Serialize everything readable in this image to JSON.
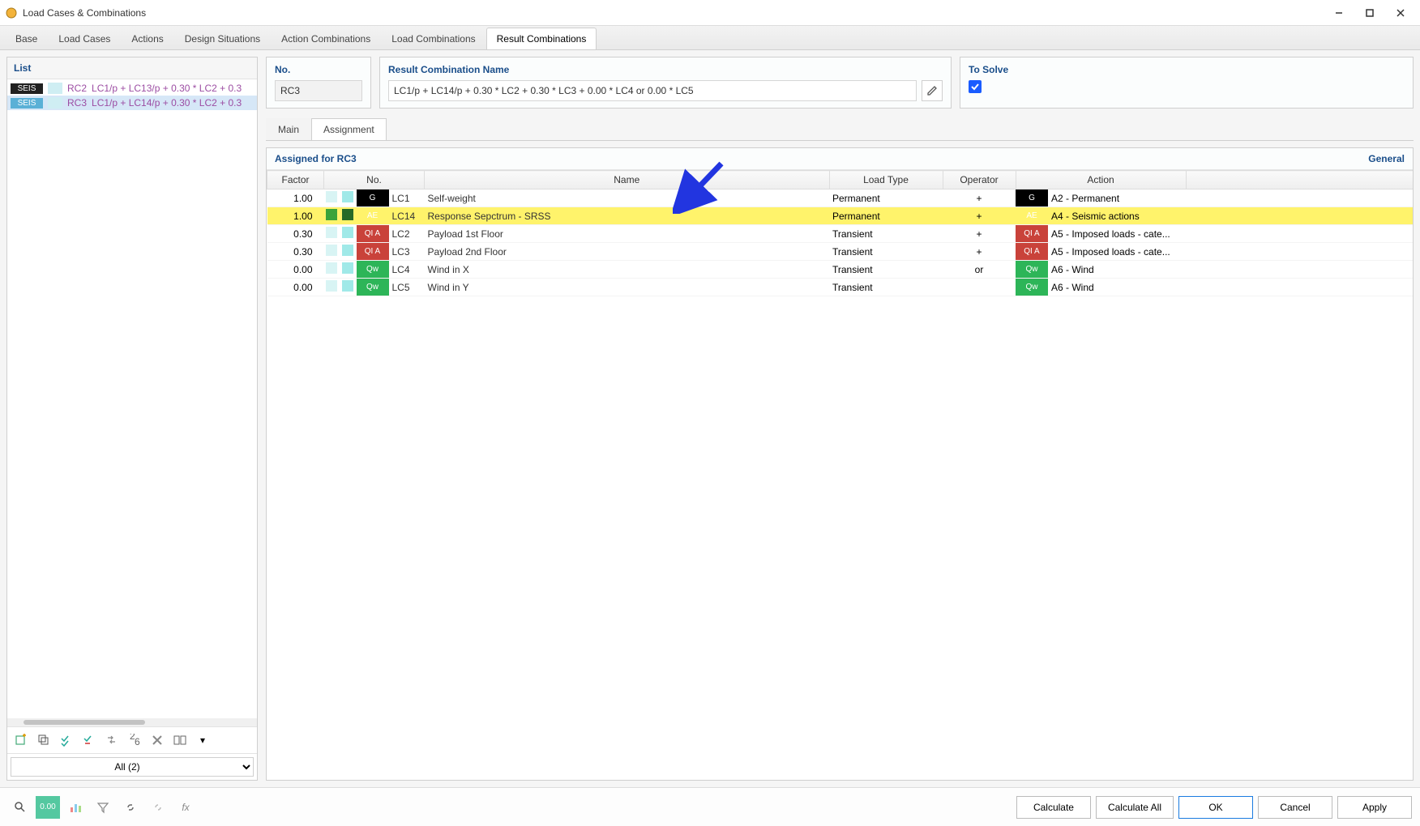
{
  "window": {
    "title": "Load Cases & Combinations"
  },
  "tabs": [
    "Base",
    "Load Cases",
    "Actions",
    "Design Situations",
    "Action Combinations",
    "Load Combinations",
    "Result Combinations"
  ],
  "activeTab": 6,
  "list": {
    "title": "List",
    "items": [
      {
        "tag": "SEIS",
        "rc": "RC2",
        "desc": "LC1/p + LC13/p + 0.30 * LC2 + 0.3",
        "selected": false
      },
      {
        "tag": "SEIS",
        "rc": "RC3",
        "desc": "LC1/p + LC14/p + 0.30 * LC2 + 0.3",
        "selected": true
      }
    ],
    "filter": "All (2)"
  },
  "header": {
    "no_label": "No.",
    "no_value": "RC3",
    "name_label": "Result Combination Name",
    "name_value": "LC1/p + LC14/p + 0.30 * LC2 + 0.30 * LC3 + 0.00 * LC4 or 0.00 * LC5",
    "solve_label": "To Solve",
    "solve_checked": true
  },
  "subtabs": {
    "main": "Main",
    "assignment": "Assignment"
  },
  "grid": {
    "title": "Assigned for RC3",
    "general": "General",
    "cols": {
      "factor": "Factor",
      "no": "No.",
      "name": "Name",
      "loadtype": "Load Type",
      "operator": "Operator",
      "action": "Action"
    },
    "rows": [
      {
        "factor": "1.00",
        "cat": "G",
        "catClass": "cat-G",
        "lc": "LC1",
        "name": "Self-weight",
        "loadtype": "Permanent",
        "op": "+",
        "acat": "G",
        "acatClass": "cat-G",
        "action": "A2 - Permanent",
        "hlt": false
      },
      {
        "factor": "1.00",
        "cat": "AE",
        "catClass": "cat-AE",
        "lc": "LC14",
        "name": "Response Sepctrum - SRSS",
        "loadtype": "Permanent",
        "op": "+",
        "acat": "AE",
        "acatClass": "cat-AE",
        "action": "A4 - Seismic actions",
        "hlt": true
      },
      {
        "factor": "0.30",
        "cat": "QI A",
        "catClass": "cat-QIA",
        "lc": "LC2",
        "name": "Payload 1st Floor",
        "loadtype": "Transient",
        "op": "+",
        "acat": "QI A",
        "acatClass": "cat-QIA",
        "action": "A5 - Imposed loads - cate...",
        "hlt": false
      },
      {
        "factor": "0.30",
        "cat": "QI A",
        "catClass": "cat-QIA",
        "lc": "LC3",
        "name": "Payload 2nd Floor",
        "loadtype": "Transient",
        "op": "+",
        "acat": "QI A",
        "acatClass": "cat-QIA",
        "action": "A5 - Imposed loads - cate...",
        "hlt": false
      },
      {
        "factor": "0.00",
        "cat": "Qw",
        "catClass": "cat-Qw",
        "lc": "LC4",
        "name": "Wind in X",
        "loadtype": "Transient",
        "op": "or",
        "acat": "Qw",
        "acatClass": "cat-Qw",
        "action": "A6 - Wind",
        "hlt": false
      },
      {
        "factor": "0.00",
        "cat": "Qw",
        "catClass": "cat-Qw",
        "lc": "LC5",
        "name": "Wind in Y",
        "loadtype": "Transient",
        "op": "",
        "acat": "Qw",
        "acatClass": "cat-Qw",
        "action": "A6 - Wind",
        "hlt": false
      }
    ]
  },
  "footer": {
    "calculate": "Calculate",
    "calculate_all": "Calculate All",
    "ok": "OK",
    "cancel": "Cancel",
    "apply": "Apply"
  }
}
